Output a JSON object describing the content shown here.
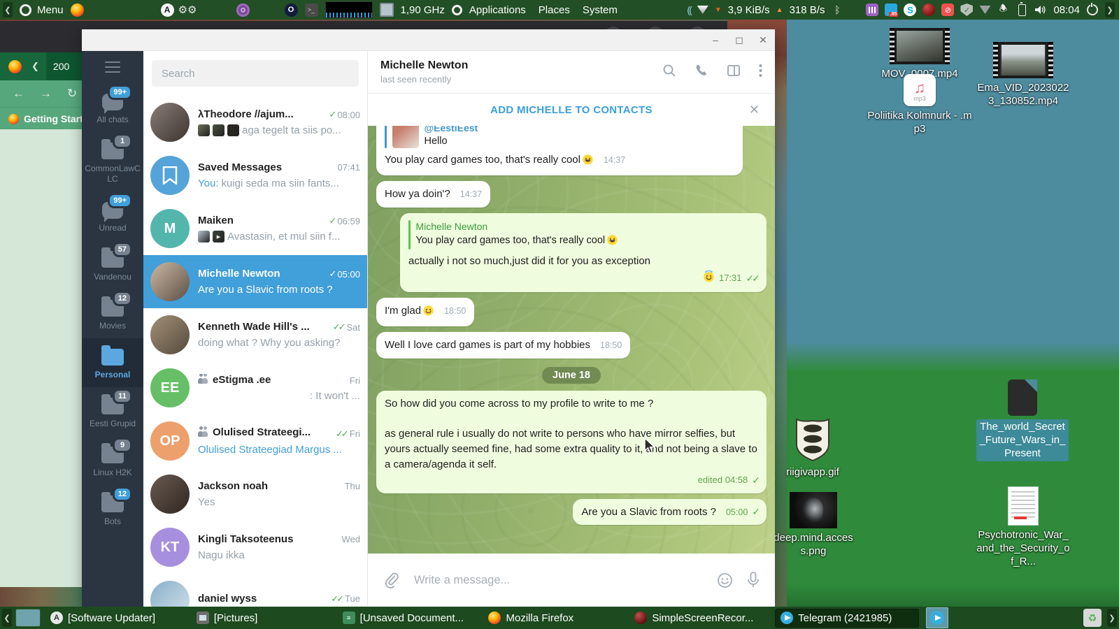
{
  "panel": {
    "menu_label": "Menu",
    "cpu_freq": "1,90 GHz",
    "applications_label": "Applications",
    "places_label": "Places",
    "system_label": "System",
    "net_down": "3,9 KiB/s",
    "net_up": "318 B/s",
    "clock": "08:04"
  },
  "firefox": {
    "window_title": "Mozilla Firefox",
    "tab_label": "200",
    "bookmark_label": "Getting Started"
  },
  "telegram": {
    "search_placeholder": "Search",
    "folders": [
      {
        "label": "All chats",
        "badge": "99+",
        "badge_style": "blue",
        "icon": "chats"
      },
      {
        "label": "CommonLawCLC",
        "badge": "1",
        "badge_style": "gray",
        "icon": "folder"
      },
      {
        "label": "Unread",
        "badge": "99+",
        "badge_style": "blue",
        "icon": "chats"
      },
      {
        "label": "Vandenou",
        "badge": "57",
        "badge_style": "gray",
        "icon": "folder"
      },
      {
        "label": "Movies",
        "badge": "12",
        "badge_style": "gray",
        "icon": "folder"
      },
      {
        "label": "Personal",
        "badge": "",
        "badge_style": "",
        "icon": "folder",
        "active": true
      },
      {
        "label": "Eesti Grupid",
        "badge": "11",
        "badge_style": "gray",
        "icon": "folder"
      },
      {
        "label": "Linux H2K",
        "badge": "9",
        "badge_style": "gray",
        "icon": "folder"
      },
      {
        "label": "Bots",
        "badge": "12",
        "badge_style": "blue",
        "icon": "folder"
      }
    ],
    "chats": [
      {
        "name": "λTheodore //ajum...",
        "time": "08:00",
        "checks": 1,
        "preview": "aga tegelt ta siis po...",
        "thumbs": [
          "#6b705c",
          "#4a5243",
          "#2e2a24"
        ],
        "avatar": {
          "type": "photo",
          "colors": [
            "#8a7d76",
            "#3c3431"
          ]
        }
      },
      {
        "name": "Saved Messages",
        "time": "07:41",
        "checks": 0,
        "preview": " kuigi seda ma siin fants...",
        "preview_prefix": "You:",
        "avatar": {
          "type": "saved",
          "color": "#55a4d9"
        }
      },
      {
        "name": "Maiken",
        "time": "06:59",
        "checks": 1,
        "preview": "Avastasin, et mul siin f...",
        "thumbs": [
          "#b9c6cf",
          "#39453a"
        ],
        "thumb_play": true,
        "avatar": {
          "type": "initials",
          "text": "M",
          "color": "#53b6ad"
        }
      },
      {
        "name": "Michelle Newton",
        "time": "05:00",
        "checks": 1,
        "preview": "Are you a Slavic from roots ?",
        "selected": true,
        "avatar": {
          "type": "photo",
          "colors": [
            "#cbb9a4",
            "#5d4f46"
          ]
        }
      },
      {
        "name": "Kenneth Wade Hill's ...",
        "time": "Sat",
        "checks": 2,
        "preview": "doing what ? Why you asking?",
        "avatar": {
          "type": "photo",
          "colors": [
            "#a29078",
            "#564a3c"
          ]
        }
      },
      {
        "name": "eStigma .ee",
        "time": "Fri",
        "checks": 0,
        "group": true,
        "preview": ": It won't ...",
        "preview_align": "right",
        "avatar": {
          "type": "initials",
          "text": "EE",
          "color": "#66bf66"
        }
      },
      {
        "name": "Olulised Strateegi...",
        "time": "Fri",
        "checks": 2,
        "group": true,
        "preview": "Olulised Strateegiad Margus ...",
        "preview_blue": true,
        "avatar": {
          "type": "initials",
          "text": "OP",
          "color": "#eda06c"
        }
      },
      {
        "name": "Jackson noah",
        "time": "Thu",
        "checks": 0,
        "preview": "Yes",
        "avatar": {
          "type": "photo",
          "colors": [
            "#6a5a50",
            "#2f2721"
          ]
        }
      },
      {
        "name": "Kingli Taksoteenus",
        "time": "Wed",
        "checks": 0,
        "preview": "Nagu ikka",
        "avatar": {
          "type": "initials",
          "text": "KT",
          "color": "#a78fe0"
        }
      },
      {
        "name": "daniel wyss",
        "time": "Tue",
        "checks": 2,
        "preview": "",
        "avatar": {
          "type": "photo",
          "colors": [
            "#86aec9",
            "#d7e3ea"
          ]
        }
      }
    ],
    "header": {
      "name": "Michelle Newton",
      "status": "last seen recently"
    },
    "banner_label": "ADD MICHELLE TO CONTACTS",
    "messages": [
      {
        "type": "in",
        "clipped": true,
        "wide": true,
        "reply": {
          "title": "@EestiEest",
          "title_color": "blue",
          "text": "Hello",
          "thumb": [
            "#c77f6e",
            "#e8e3da"
          ]
        },
        "text": "You play card games too, that's really cool😄",
        "time": "14:37"
      },
      {
        "type": "in",
        "text": "How ya doin'?",
        "time": "14:37"
      },
      {
        "type": "out",
        "wide": true,
        "reply": {
          "title": "Michelle Newton",
          "title_color": "green",
          "text": "You play card games too, that's really cool😄"
        },
        "text": "actually i not so much,just did it for you as exception",
        "meta_emoji": "😇",
        "time": "17:31",
        "checks": 2
      },
      {
        "type": "in",
        "text": "I'm glad😊",
        "time": "18:50"
      },
      {
        "type": "in",
        "text": "Well I love card games is part of my hobbies",
        "time": "18:50"
      },
      {
        "type": "date",
        "text": "June 18"
      },
      {
        "type": "out",
        "wide": true,
        "text": "So how did you come across to my profile to write to me ?\n\nas general rule i usually do not write to persons who have mirror selfies, but yours actually seemed fine, had some extra quality to it, and not being a slave to a camera/agenda it self.",
        "time": "edited 04:58",
        "checks": 1
      },
      {
        "type": "out",
        "text": "Are you a Slavic from roots ?",
        "time": "05:00",
        "checks": 1
      }
    ],
    "compose_placeholder": "Write a message..."
  },
  "desktop": {
    "icons": [
      {
        "label": "MOV_0007.mp4",
        "kind": "video"
      },
      {
        "label": "Ema_VID_20230223_130852.mp4",
        "kind": "video2"
      },
      {
        "label": "Poliitika Kolmnurk - .mp3",
        "kind": "mp3"
      },
      {
        "label": "The_world_Secret_Future_Wars_in_Present",
        "kind": "file-dark",
        "selected": true
      },
      {
        "label": "riigivapp.gif",
        "kind": "shield"
      },
      {
        "label": "deep.mind.access.png",
        "kind": "image-dark"
      },
      {
        "label": "Psychotronic_War_and_the_Security_of_R...",
        "kind": "doc"
      }
    ]
  },
  "taskbar": {
    "buttons": [
      {
        "label": "[Software Updater]",
        "icon": "updater"
      },
      {
        "label": "[Pictures]",
        "icon": "pictures"
      },
      {
        "label": "[Unsaved Document...",
        "icon": "document"
      },
      {
        "label": "Mozilla Firefox",
        "icon": "firefox"
      },
      {
        "label": "SimpleScreenRecor...",
        "icon": "ssr"
      },
      {
        "label": "Telegram (2421985)",
        "icon": "telegram",
        "active": true
      }
    ]
  }
}
